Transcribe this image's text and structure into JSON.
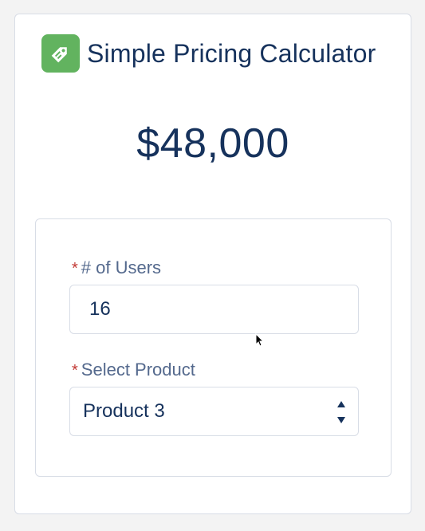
{
  "card": {
    "title": "Simple Pricing Calculator",
    "icon": "price-tag-icon",
    "total_price": "$48,000"
  },
  "form": {
    "users": {
      "required_marker": "*",
      "label": "# of Users",
      "value": "16"
    },
    "product": {
      "required_marker": "*",
      "label": "Select Product",
      "selected": "Product 3"
    }
  },
  "colors": {
    "icon_bg": "#62b35f",
    "text_primary": "#16325c",
    "label_text": "#54698d",
    "required": "#c23934",
    "border": "#d8dde6"
  }
}
